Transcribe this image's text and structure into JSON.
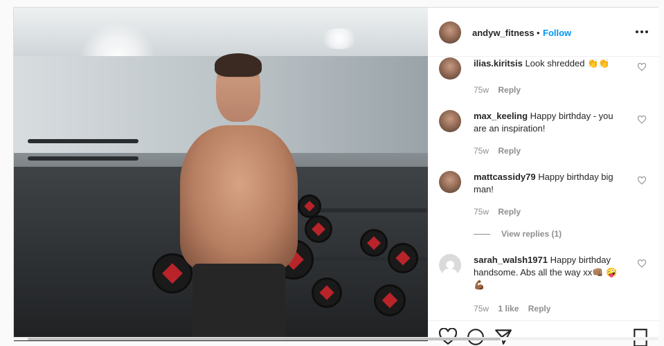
{
  "post": {
    "author": "andyw_fitness",
    "separator": "•",
    "follow_label": "Follow"
  },
  "comments": [
    {
      "user": "ilias.kiritsis",
      "text": "Look shredded 👏👏",
      "age": "75w",
      "likes": "",
      "reply": "Reply"
    },
    {
      "user": "max_keeling",
      "text": "Happy birthday - you are an inspiration!",
      "age": "75w",
      "likes": "",
      "reply": "Reply"
    },
    {
      "user": "mattcassidy79",
      "text": "Happy birthday big man!",
      "age": "75w",
      "likes": "",
      "reply": "Reply"
    },
    {
      "user": "sarah_walsh1971",
      "text": "Happy birthday handsome. Abs all the way xx👊🏽 🤪💪🏾",
      "age": "75w",
      "likes": "1 like",
      "reply": "Reply"
    }
  ],
  "view_replies": "View replies (1)",
  "icons": {
    "more": "more-options-icon",
    "like": "heart-icon",
    "comment": "comment-icon",
    "share": "share-icon",
    "save": "bookmark-icon"
  },
  "colors": {
    "accent": "#0095f6",
    "text": "#262626",
    "muted": "#8e8e8e",
    "border": "#dbdbdb"
  }
}
